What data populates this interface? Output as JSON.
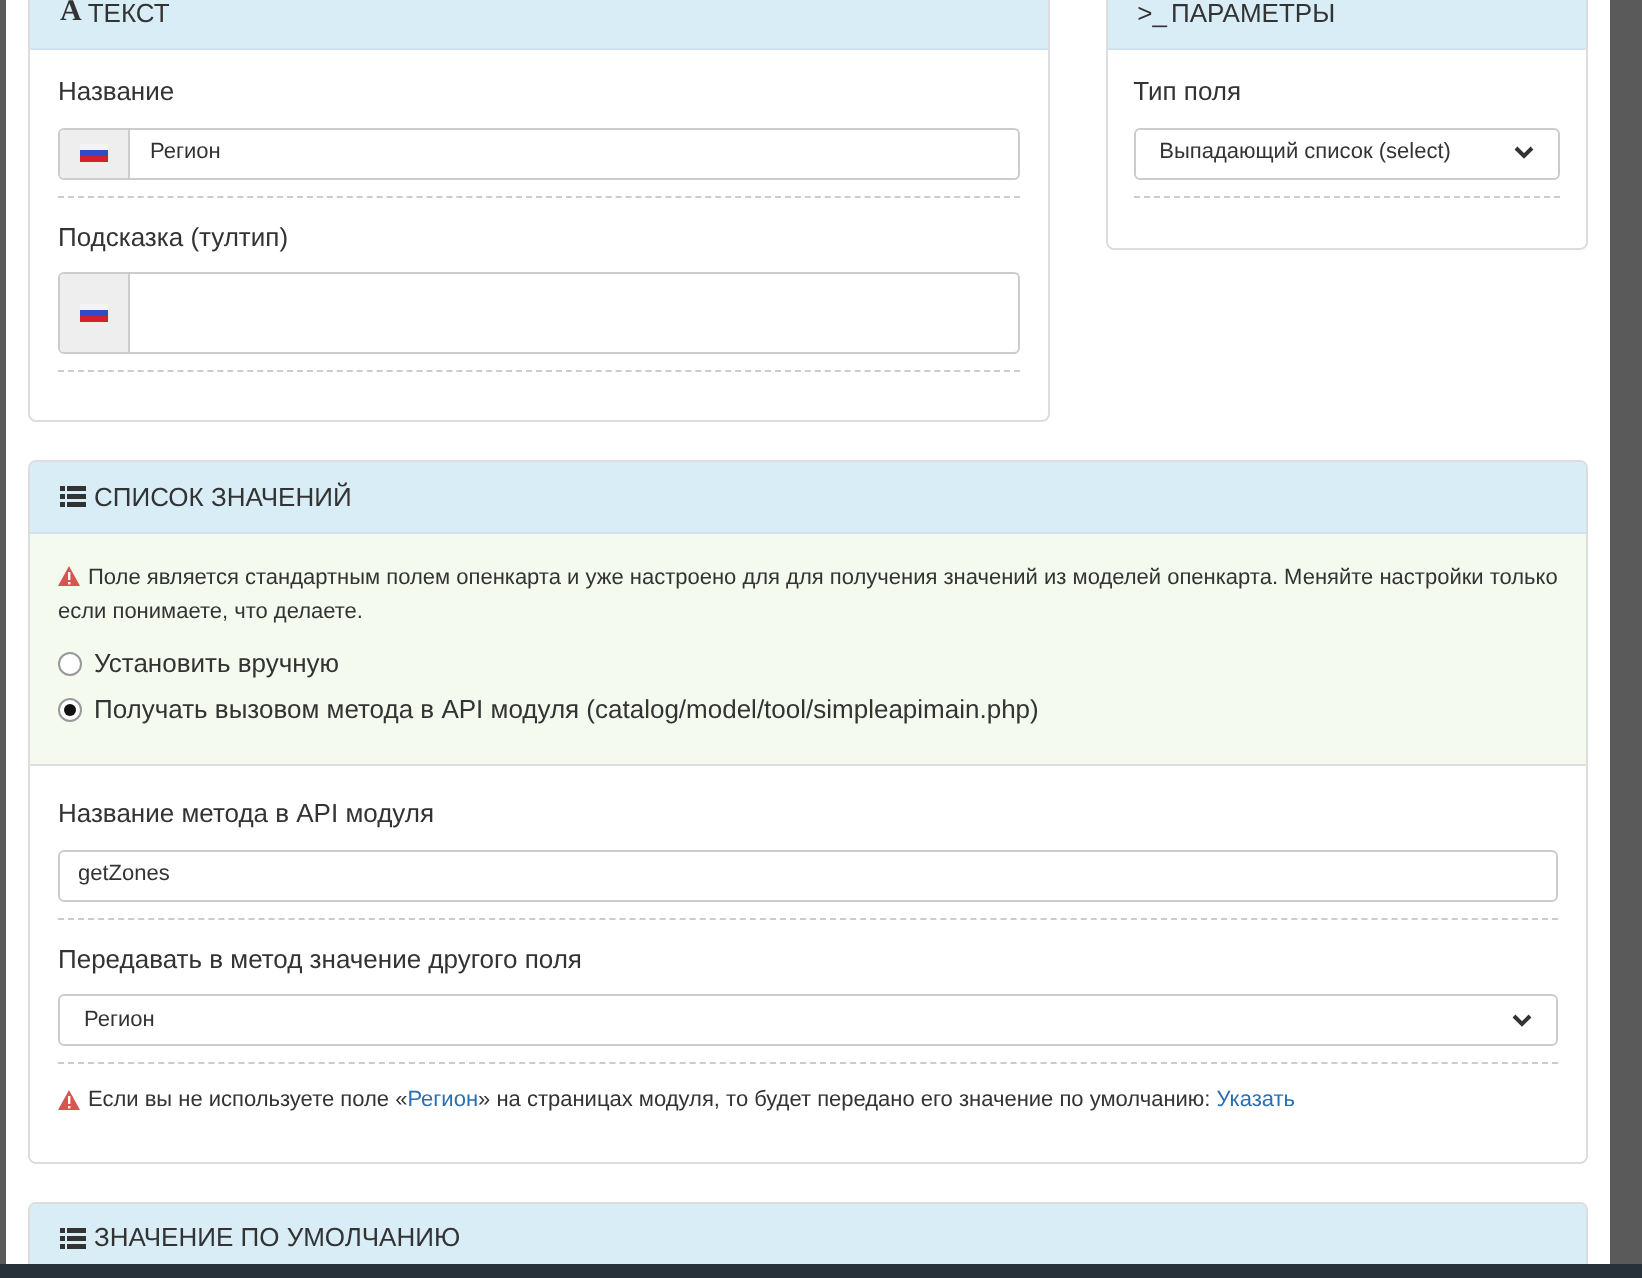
{
  "text_panel": {
    "icon": "A",
    "title": "ТЕКСТ",
    "fields": [
      {
        "kind": "input",
        "label": "Название",
        "value": "Регион"
      },
      {
        "kind": "textarea",
        "label": "Подсказка (тултип)"
      }
    ]
  },
  "params_panel": {
    "icon": ">_",
    "title": "ПАРАМЕТРЫ",
    "field_type": {
      "label": "Тип поля",
      "value": "Выпадающий список (select)"
    }
  },
  "values_panel": {
    "title": "СПИСОК ЗНАЧЕНИЙ",
    "warning": "Поле является стандартным полем опенкарта и уже настроено для для получения значений из моделей опенкарта. Меняйте настройки только если понимаете, что делаете.",
    "options": [
      {
        "label": "Установить вручную",
        "selected": false
      },
      {
        "label": "Получать вызовом метода в API модуля (catalog/model/tool/simpleapimain.php)",
        "selected": true
      }
    ],
    "method_name": {
      "label": "Название метода в API модуля",
      "value": "getZones"
    },
    "pass_field": {
      "label": "Передавать в метод значение другого поля",
      "value": "Регион"
    },
    "note": {
      "before": "Если вы не используете поле «",
      "link": "Регион",
      "after": "» на страницах модуля, то будет передано его значение по умолчанию: ",
      "action": "Указать"
    }
  },
  "default_panel": {
    "title": "ЗНАЧЕНИЕ ПО УМОЛЧАНИЮ"
  }
}
